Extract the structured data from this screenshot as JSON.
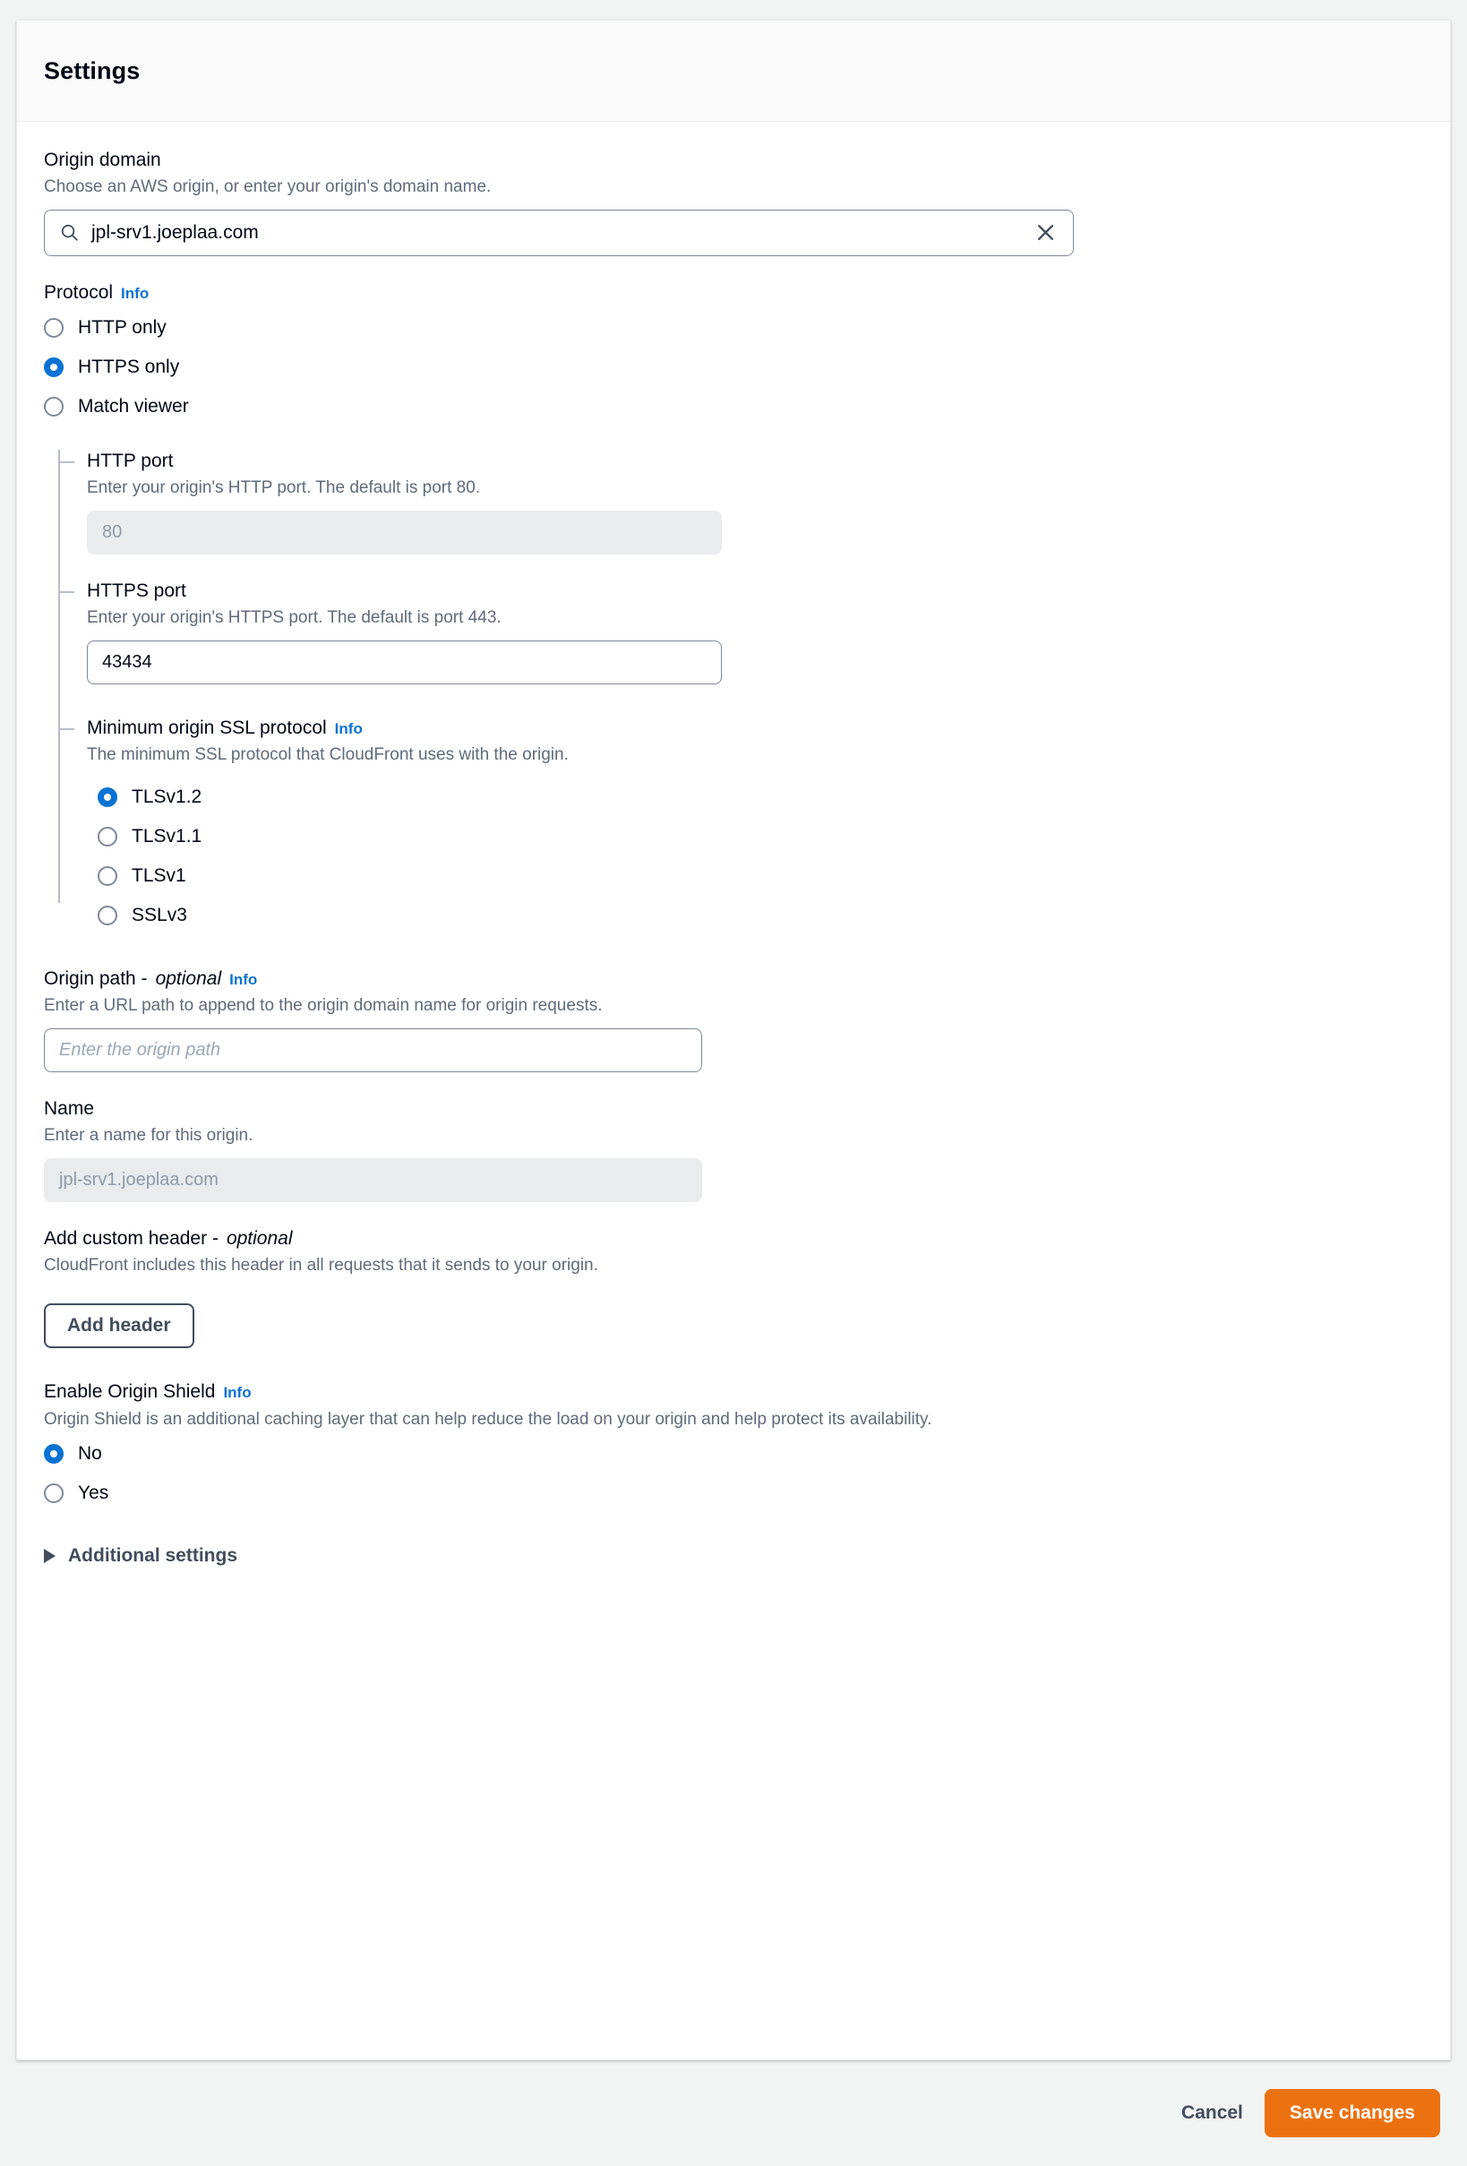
{
  "card": {
    "title": "Settings"
  },
  "origin_domain": {
    "label": "Origin domain",
    "description": "Choose an AWS origin, or enter your origin's domain name.",
    "value": "jpl-srv1.joeplaa.com",
    "search_icon": "search-icon",
    "clear_icon": "close-icon"
  },
  "protocol": {
    "label": "Protocol",
    "info": "Info",
    "options": [
      {
        "label": "HTTP only",
        "selected": false
      },
      {
        "label": "HTTPS only",
        "selected": true
      },
      {
        "label": "Match viewer",
        "selected": false
      }
    ]
  },
  "http_port": {
    "label": "HTTP port",
    "description": "Enter your origin's HTTP port. The default is port 80.",
    "value": "80",
    "disabled": true
  },
  "https_port": {
    "label": "HTTPS port",
    "description": "Enter your origin's HTTPS port. The default is port 443.",
    "value": "43434",
    "disabled": false
  },
  "min_ssl": {
    "label": "Minimum origin SSL protocol",
    "info": "Info",
    "description": "The minimum SSL protocol that CloudFront uses with the origin.",
    "options": [
      {
        "label": "TLSv1.2",
        "selected": true
      },
      {
        "label": "TLSv1.1",
        "selected": false
      },
      {
        "label": "TLSv1",
        "selected": false
      },
      {
        "label": "SSLv3",
        "selected": false
      }
    ]
  },
  "origin_path": {
    "label": "Origin path -",
    "optional": "optional",
    "info": "Info",
    "description": "Enter a URL path to append to the origin domain name for origin requests.",
    "placeholder": "Enter the origin path",
    "value": ""
  },
  "name": {
    "label": "Name",
    "description": "Enter a name for this origin.",
    "value": "jpl-srv1.joeplaa.com",
    "disabled": true
  },
  "custom_header": {
    "label": "Add custom header -",
    "optional": "optional",
    "description": "CloudFront includes this header in all requests that it sends to your origin.",
    "button_label": "Add header"
  },
  "origin_shield": {
    "label": "Enable Origin Shield",
    "info": "Info",
    "description": "Origin Shield is an additional caching layer that can help reduce the load on your origin and help protect its availability.",
    "options": [
      {
        "label": "No",
        "selected": true
      },
      {
        "label": "Yes",
        "selected": false
      }
    ]
  },
  "additional_settings": {
    "label": "Additional settings",
    "expanded": false,
    "caret_icon": "caret-right-icon"
  },
  "footer": {
    "cancel_label": "Cancel",
    "save_label": "Save changes"
  },
  "colors": {
    "accent_blue": "#0972d3",
    "primary_orange": "#ec7211",
    "text_primary": "#000716",
    "text_secondary": "#5f6b7a",
    "border": "#7d8998"
  }
}
